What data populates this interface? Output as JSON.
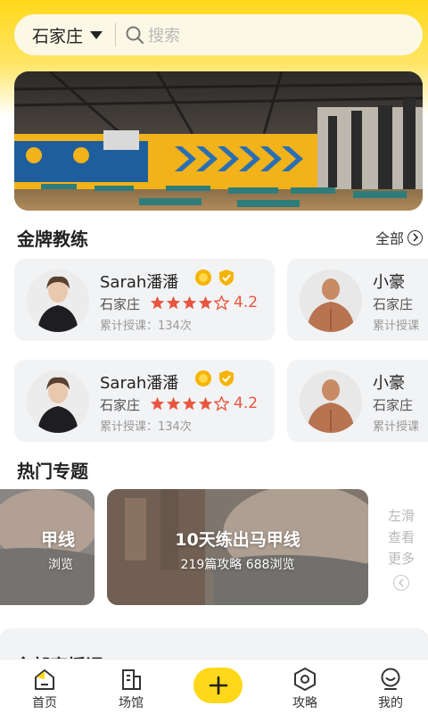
{
  "header": {
    "city": "石家庄",
    "search_placeholder": "搜索"
  },
  "sections": {
    "coaches_title": "金牌教练",
    "all_label": "全部",
    "topics_title": "热门专题",
    "live_title": "全部直播课"
  },
  "coaches": [
    {
      "name": "Sarah潘潘",
      "city": "石家庄",
      "rating": "4.2",
      "stars": 4,
      "lessons": "累计授课：134次"
    },
    {
      "name": "小豪",
      "city": "石家庄",
      "lessons": "累计授课"
    },
    {
      "name": "Sarah潘潘",
      "city": "石家庄",
      "rating": "4.2",
      "stars": 4,
      "lessons": "累计授课：134次"
    },
    {
      "name": "小豪",
      "city": "石家庄",
      "lessons": "累计授课"
    }
  ],
  "topics": [
    {
      "title": "甲线",
      "meta": "浏览"
    },
    {
      "title": "10天练出马甲线",
      "meta": "219篇攻略  688浏览"
    }
  ],
  "more_hint": [
    "左滑",
    "查看",
    "更多"
  ],
  "tabbar": {
    "home": "首页",
    "venue": "场馆",
    "guide": "攻略",
    "mine": "我的"
  },
  "colors": {
    "accent": "#ffd81a",
    "rating": "#e8563e",
    "card": "#f2f3f5"
  }
}
